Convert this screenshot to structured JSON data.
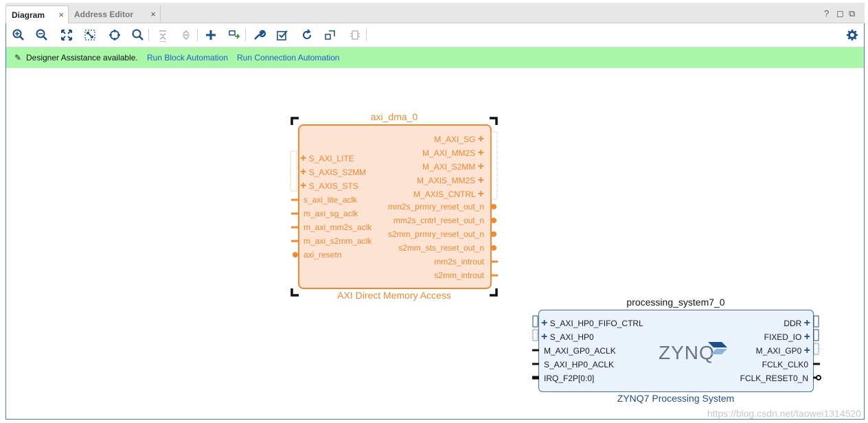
{
  "tabs": [
    {
      "label": "Diagram"
    },
    {
      "label": "Address Editor"
    }
  ],
  "window_controls": {
    "help": "?",
    "restore": "◻",
    "float": "⧉"
  },
  "assist": {
    "text": "Designer Assistance available.",
    "link_block": "Run Block Automation",
    "link_connection": "Run Connection Automation"
  },
  "dma": {
    "instance_name": "axi_dma_0",
    "ip_name": "AXI Direct Memory Access",
    "left_ports": [
      "S_AXI_LITE",
      "S_AXIS_S2MM",
      "S_AXIS_STS",
      "s_axi_lite_aclk",
      "m_axi_sg_aclk",
      "m_axi_mm2s_aclk",
      "m_axi_s2mm_aclk",
      "axi_resetn"
    ],
    "right_ports": [
      "M_AXI_SG",
      "M_AXI_MM2S",
      "M_AXI_S2MM",
      "M_AXIS_MM2S",
      "M_AXIS_CNTRL",
      "mm2s_prmry_reset_out_n",
      "mm2s_cntrl_reset_out_n",
      "s2mm_prmry_reset_out_n",
      "s2mm_sts_reset_out_n",
      "mm2s_introut",
      "s2mm_introut"
    ]
  },
  "ps": {
    "instance_name": "processing_system7_0",
    "ip_name": "ZYNQ7 Processing System",
    "logo": "ZYNQ",
    "left_ports": [
      "S_AXI_HP0_FIFO_CTRL",
      "S_AXI_HP0",
      "M_AXI_GP0_ACLK",
      "S_AXI_HP0_ACLK",
      "IRQ_F2P[0:0]"
    ],
    "right_ports": [
      "DDR",
      "FIXED_IO",
      "M_AXI_GP0",
      "FCLK_CLK0",
      "FCLK_RESET0_N"
    ]
  },
  "watermark": "https://blog.csdn.net/taowei1314520",
  "colors": {
    "dma_border": "#f08a30",
    "dma_fill": "#fde3d3",
    "ps_border": "#4a6fa5",
    "ps_fill": "#eaf2fb",
    "assist_bg": "#aaf7aa",
    "link": "#1f5cc8"
  }
}
